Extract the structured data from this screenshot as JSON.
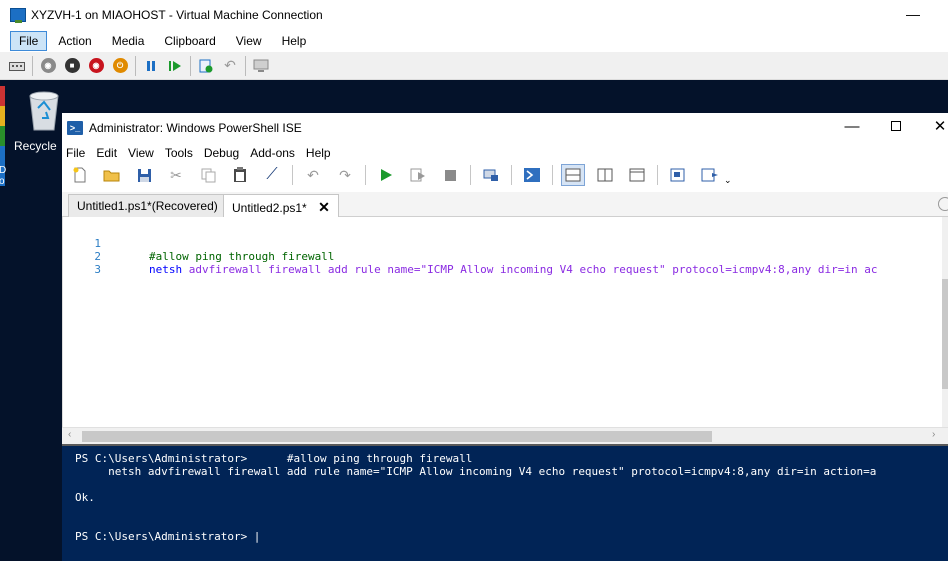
{
  "vm_window": {
    "title": "XYZVH-1 on MIAOHOST - Virtual Machine Connection",
    "minimize": "—",
    "menu": [
      "File",
      "Action",
      "Media",
      "Clipboard",
      "View",
      "Help"
    ],
    "toolbar_icons": [
      "ctrl-alt-del-icon",
      "start-icon",
      "turn-off-icon",
      "shut-down-icon",
      "power-icon",
      "pause-icon",
      "resume-icon",
      "checkpoint-icon",
      "revert-icon",
      "enhanced-session-icon"
    ]
  },
  "desktop": {
    "recycle_label": "Recycle",
    "other_label": "D\no"
  },
  "ise": {
    "title": "Administrator: Windows PowerShell ISE",
    "icon_glyph": ">_",
    "controls": {
      "minimize": "—",
      "close": "✕"
    },
    "menu": [
      "File",
      "Edit",
      "View",
      "Tools",
      "Debug",
      "Add-ons",
      "Help"
    ],
    "tabs": [
      {
        "label": "Untitled1.ps1*(Recovered)",
        "active": false
      },
      {
        "label": "Untitled2.ps1*",
        "active": true,
        "close": "✕"
      }
    ],
    "editor": {
      "line_numbers": [
        "1",
        "2",
        "3"
      ],
      "line1_comment": "#allow ping through firewall",
      "line2_cmd": "netsh",
      "line2_args": "advfirewall firewall add rule name=",
      "line2_string": "\"ICMP Allow incoming V4 echo request\"",
      "line2_rest": "protocol=icmpv4:8,any dir=in ac"
    },
    "console": {
      "line1": "PS C:\\Users\\Administrator>      #allow ping through firewall",
      "line2": "     netsh advfirewall firewall add rule name=\"ICMP Allow incoming V4 echo request\" protocol=icmpv4:8,any dir=in action=a",
      "line3": "Ok.",
      "prompt": "PS C:\\Users\\Administrator> |"
    }
  },
  "colors": {
    "desktop_bg": "#04122a",
    "console_bg": "#012456",
    "menu_active": "#cce4f7"
  }
}
